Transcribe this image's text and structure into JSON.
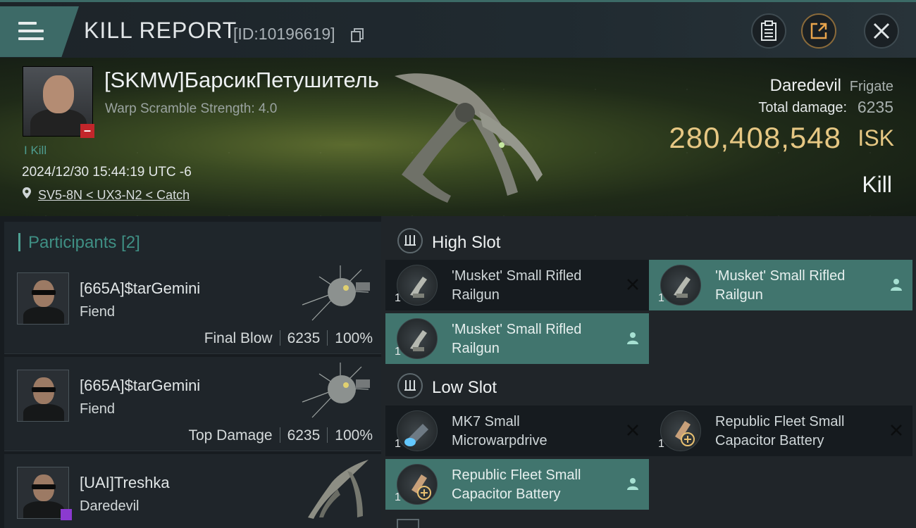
{
  "header": {
    "title": "KILL REPORT",
    "report_id": "[ID:10196619]",
    "icons": [
      "menu-icon",
      "copy-icon",
      "clipboard-icon",
      "share-icon",
      "close-icon"
    ]
  },
  "victim": {
    "name": "[SKMW]БарсикПетушитель",
    "warp_scramble": "Warp Scramble Strength: 4.0",
    "kills_tag": "I Kill",
    "datetime": "2024/12/30 15:44:19 UTC -6",
    "location": "SV5-8N < UX3-N2 < Catch",
    "ship_name": "Daredevil",
    "ship_class": "Frigate",
    "total_damage_label": "Total damage:",
    "total_damage": "6235",
    "isk_value": "280,408,548",
    "isk_unit": "ISK",
    "result": "Kill"
  },
  "participants": {
    "header": "Participants [2]",
    "rows": [
      {
        "name": "[665A]$tarGemini",
        "ship": "Fiend",
        "role": "Final Blow",
        "damage": "6235",
        "percent": "100%"
      },
      {
        "name": "[665A]$tarGemini",
        "ship": "Fiend",
        "role": "Top Damage",
        "damage": "6235",
        "percent": "100%"
      },
      {
        "name": "[UAI]Treshka",
        "ship": "Daredevil",
        "role": "",
        "damage": "",
        "percent": ""
      }
    ]
  },
  "fittings": {
    "high_slot": {
      "title": "High Slot",
      "modules": [
        {
          "name": "'Musket' Small Rifled Railgun",
          "qty": "1",
          "status": "destroyed"
        },
        {
          "name": "'Musket' Small Rifled Railgun",
          "qty": "1",
          "status": "dropped"
        },
        {
          "name": "'Musket' Small Rifled Railgun",
          "qty": "1",
          "status": "dropped"
        }
      ]
    },
    "low_slot": {
      "title": "Low Slot",
      "modules": [
        {
          "name": "MK7 Small Microwarpdrive",
          "qty": "1",
          "status": "destroyed"
        },
        {
          "name": "Republic Fleet Small Capacitor Battery",
          "qty": "1",
          "status": "destroyed"
        },
        {
          "name": "Republic Fleet Small Capacitor Battery",
          "qty": "1",
          "status": "dropped"
        }
      ]
    }
  },
  "colors": {
    "accent": "#41756e",
    "isk": "#e6c783",
    "participants_header": "#3f8f84"
  }
}
